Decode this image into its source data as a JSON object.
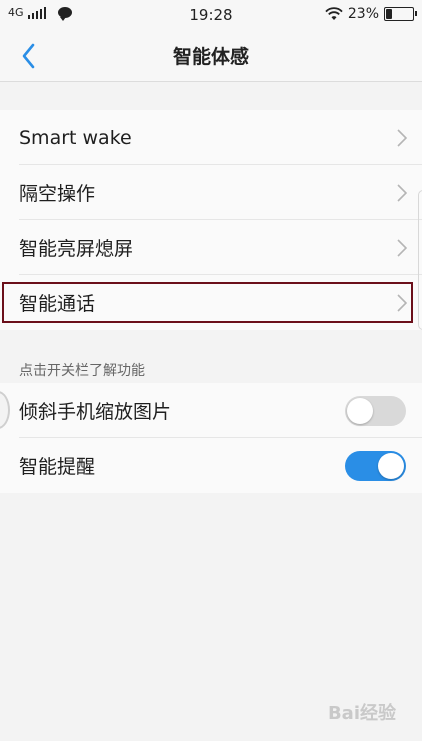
{
  "status_bar": {
    "network": "4G",
    "time": "19:28",
    "battery_percent": "23%",
    "battery_level": 0.23,
    "icons": [
      "signal-icon",
      "message-icon",
      "wifi-icon",
      "battery-icon"
    ]
  },
  "header": {
    "title": "智能体感",
    "back_icon": "chevron-left-icon"
  },
  "settings": {
    "items": [
      {
        "label": "Smart wake"
      },
      {
        "label": "隔空操作"
      },
      {
        "label": "智能亮屏熄屏"
      },
      {
        "label": "智能通话"
      }
    ]
  },
  "section": {
    "header": "点击开关栏了解功能"
  },
  "toggles": {
    "items": [
      {
        "label": "倾斜手机缩放图片",
        "on": false
      },
      {
        "label": "智能提醒",
        "on": true
      }
    ]
  },
  "colors": {
    "accent": "#2a8ee6",
    "highlight_border": "#6b0f1a",
    "background": "#f3f3f3"
  },
  "watermark": "Bai经验"
}
